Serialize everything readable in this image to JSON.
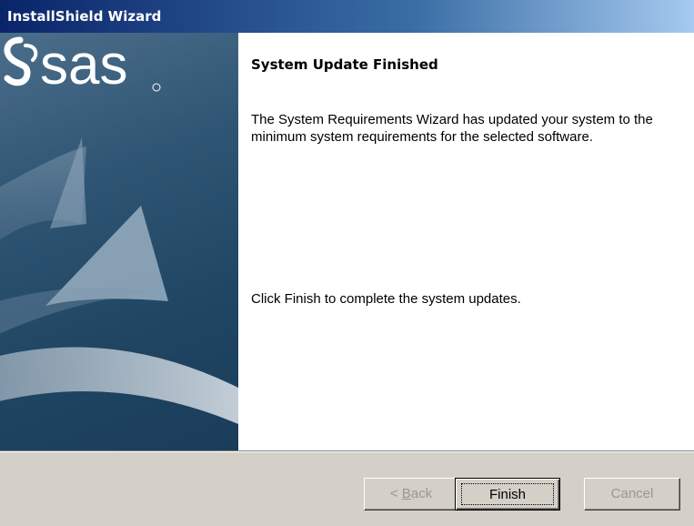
{
  "window": {
    "title": "InstallShield Wizard"
  },
  "banner": {
    "logo_text": "sas",
    "logo_icon": "sas-logo-icon"
  },
  "content": {
    "heading": "System Update Finished",
    "description": "The System Requirements Wizard has updated your system to the minimum system requirements for the selected software.",
    "finish_instruction": "Click Finish to complete the system updates."
  },
  "buttons": {
    "back_prefix": "< ",
    "back_mnemonic": "B",
    "back_rest": "ack",
    "finish": "Finish",
    "cancel": "Cancel"
  },
  "colors": {
    "titlebar_start": "#0a246a",
    "titlebar_end": "#a6caf0",
    "banner_bg": "#2f5574",
    "dialog_bg": "#d4d0c8",
    "disabled_text": "#9b978f"
  }
}
